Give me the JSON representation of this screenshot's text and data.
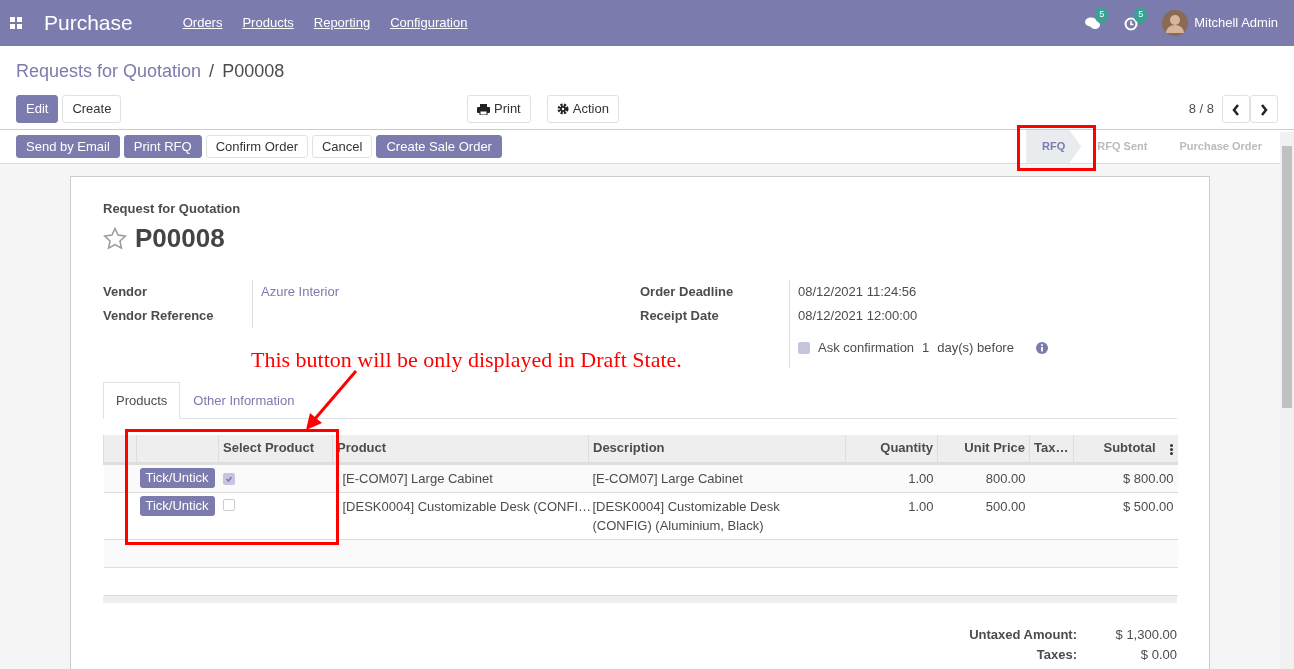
{
  "navbar": {
    "app_title": "Purchase",
    "menu": [
      "Orders",
      "Products",
      "Reporting",
      "Configuration"
    ],
    "messages_count": "5",
    "activities_count": "5",
    "user": "Mitchell Admin"
  },
  "breadcrumb": {
    "parent": "Requests for Quotation",
    "separator": "/",
    "current": "P00008"
  },
  "control_buttons": [
    {
      "label": "Edit",
      "primary": true
    },
    {
      "label": "Create",
      "primary": false
    }
  ],
  "action_buttons": [
    {
      "label": "Print",
      "kind": "print"
    },
    {
      "label": "Action",
      "kind": "action"
    }
  ],
  "pager": "8 / 8",
  "header_buttons": [
    {
      "label": "Send by Email",
      "primary": true
    },
    {
      "label": "Print RFQ",
      "primary": true
    },
    {
      "label": "Confirm Order",
      "primary": false
    },
    {
      "label": "Cancel",
      "primary": false
    },
    {
      "label": "Create Sale Order",
      "primary": true
    }
  ],
  "stages": [
    {
      "label": "RFQ",
      "selected": true
    },
    {
      "label": "RFQ Sent",
      "selected": false
    },
    {
      "label": "Purchase Order",
      "selected": false
    }
  ],
  "form": {
    "subtitle": "Request for Quotation",
    "title": "P00008",
    "starred": false,
    "left_fields": [
      {
        "label": "Vendor",
        "value": "Azure Interior",
        "link": true
      },
      {
        "label": "Vendor Reference"
      }
    ],
    "right_fields": [
      {
        "label": "Order Deadline",
        "value": "08/12/2021 11:24:56"
      },
      {
        "label": "Receipt Date",
        "value": "08/12/2021 12:00:00"
      }
    ],
    "ask_confirmation": {
      "checked": true,
      "label": "Ask confirmation",
      "days": "1",
      "suffix": "day(s) before"
    }
  },
  "annotation": "This button will be only displayed in Draft State.",
  "tabs": [
    {
      "label": "Products",
      "selected": true
    },
    {
      "label": "Other Information",
      "selected": false
    }
  ],
  "table": {
    "columns": [
      "Select Product",
      "Product",
      "Description",
      "Quantity",
      "Unit Price",
      "Tax…",
      "Subtotal"
    ],
    "rows": [
      {
        "button": "Tick/Untick",
        "checked": true,
        "product": "[E-COM07] Large Cabinet",
        "description": "[E-COM07] Large Cabinet",
        "quantity": "1.00",
        "unit_price": "800.00",
        "subtotal": "$ 800.00"
      },
      {
        "button": "Tick/Untick",
        "checked": false,
        "product": "[DESK0004] Customizable Desk (CONFI…",
        "description": "[DESK0004] Customizable Desk (CONFIG) (Aluminium, Black)",
        "quantity": "1.00",
        "unit_price": "500.00",
        "subtotal": "$ 500.00"
      }
    ]
  },
  "totals": [
    {
      "label": "Untaxed Amount:",
      "value": "$ 1,300.00"
    },
    {
      "label": "Taxes:",
      "value": "$ 0.00"
    }
  ]
}
